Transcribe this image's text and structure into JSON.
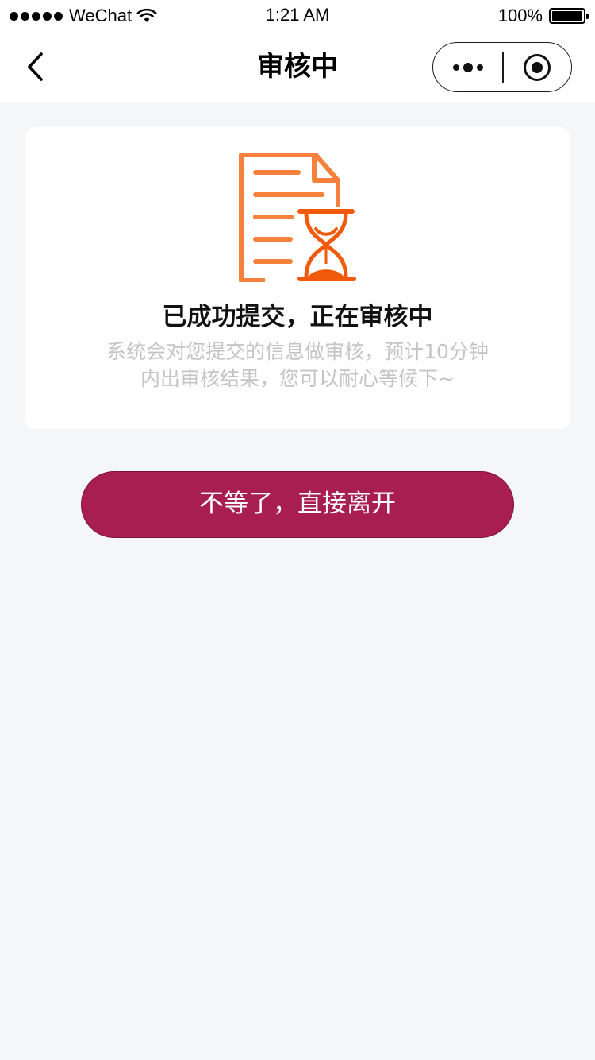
{
  "status_bar": {
    "carrier": "WeChat",
    "time": "1:21 AM",
    "battery": "100%",
    "battery_level": 1.0
  },
  "nav": {
    "title": "审核中",
    "back_icon": "chevron-left-icon",
    "more_icon": "more-dots-icon",
    "close_icon": "target-circle-icon"
  },
  "card": {
    "icon": "document-hourglass-icon",
    "title": "已成功提交，正在审核中",
    "description_line1": "系统会对您提交的信息做审核，预计10分钟",
    "description_line2": "内出审核结果，您可以耐心等候下~"
  },
  "actions": {
    "leave_label": "不等了，直接离开"
  },
  "colors": {
    "primary_button": "#a91e50",
    "icon_orange": "#f5813c",
    "hourglass_orange": "#f05a0a",
    "page_background": "#f5f6f8"
  }
}
